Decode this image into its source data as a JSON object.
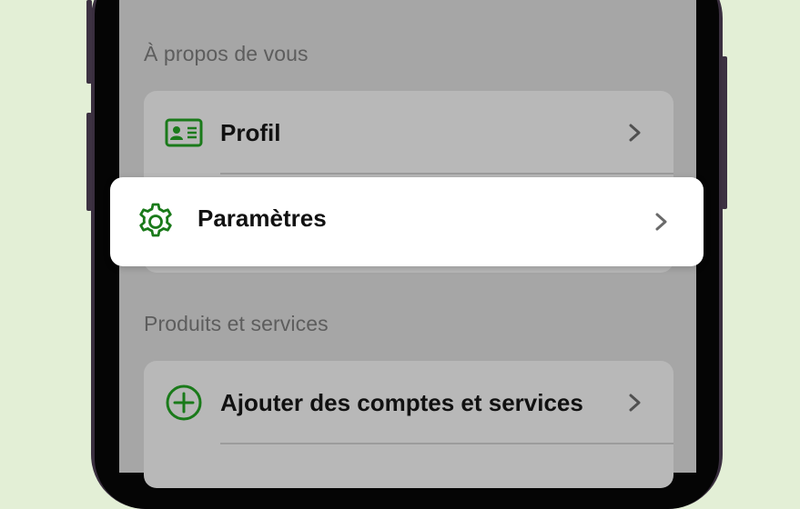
{
  "colors": {
    "background": "#e3efd6",
    "accent_green": "#1a7a1a",
    "dimmed_overlay": "#a6a6a6",
    "highlight_card": "#ffffff"
  },
  "about_section": {
    "header": "À propos de vous",
    "items": [
      {
        "label": "Profil",
        "icon": "id-card-icon"
      }
    ]
  },
  "highlighted_item": {
    "label": "Paramètres",
    "icon": "gear-icon"
  },
  "products_section": {
    "header": "Produits et services",
    "items": [
      {
        "label": "Ajouter des comptes et services",
        "icon": "plus-circle-icon"
      }
    ]
  }
}
